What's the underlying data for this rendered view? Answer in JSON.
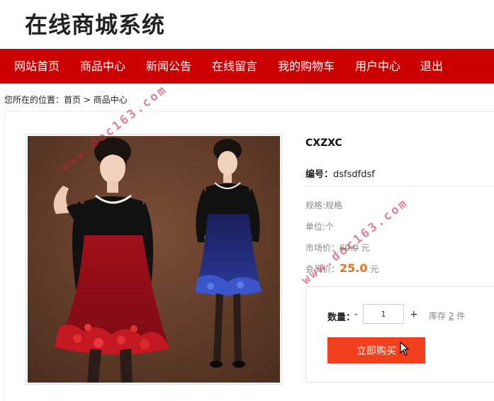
{
  "site": {
    "title": "在线商城系统"
  },
  "nav": {
    "items": [
      {
        "label": "网站首页"
      },
      {
        "label": "商品中心"
      },
      {
        "label": "新闻公告"
      },
      {
        "label": "在线留言"
      },
      {
        "label": "我的购物车"
      },
      {
        "label": "用户中心"
      },
      {
        "label": "退出"
      }
    ],
    "bg_color": "#cc0000"
  },
  "breadcrumb": {
    "prefix": "您所在的位置：",
    "home": "首页",
    "separator": " > ",
    "current": "商品中心"
  },
  "product": {
    "name": "CXZXC",
    "code_label": "编号：",
    "code": "dsfsdfdsf",
    "spec_label": "规格:",
    "spec": "规格",
    "unit_label": "单位:",
    "unit": "个",
    "market_price_label": "市场价：",
    "market_price": "60.0",
    "market_price_unit": "元",
    "member_price_label": "会员价：",
    "member_price": "25.0",
    "member_price_unit": "元",
    "accent_color": "#e8731f"
  },
  "purchase": {
    "qty_label": "数量：",
    "minus": "-",
    "qty": "1",
    "plus": "+",
    "stock_label": "库存",
    "stock": "2",
    "stock_unit": "件",
    "buy_label": "立即购买",
    "buy_color": "#f2401f"
  },
  "watermark": "www.doc163.com"
}
